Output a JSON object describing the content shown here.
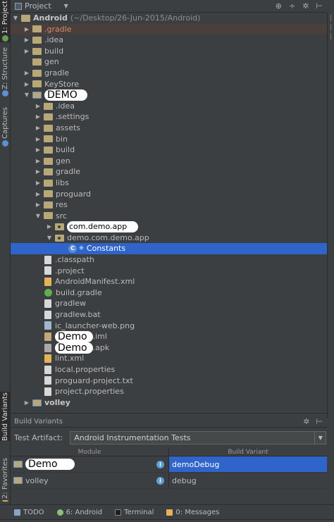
{
  "left_strip": {
    "project": "1: Project",
    "structure": "Z: Structure",
    "captures": "Captures",
    "build_variants": "Build Variants",
    "favorites": "2: Favorites"
  },
  "header": {
    "title": "Project"
  },
  "tree": [
    {
      "label": "Android",
      "path": "(~/Desktop/26-Jun-2015/Android)",
      "bold": true
    },
    {
      "label": ".gradle"
    },
    {
      "label": ".idea"
    },
    {
      "label": "build"
    },
    {
      "label": "gen"
    },
    {
      "label": "gradle"
    },
    {
      "label": "KeyStore"
    },
    {
      "label": "DEMO"
    },
    {
      "label": ".idea"
    },
    {
      "label": ".settings"
    },
    {
      "label": "assets"
    },
    {
      "label": "bin"
    },
    {
      "label": "build"
    },
    {
      "label": "gen"
    },
    {
      "label": "gradle"
    },
    {
      "label": "libs"
    },
    {
      "label": "proguard"
    },
    {
      "label": "res"
    },
    {
      "label": "src"
    },
    {
      "label": "com.demo.app"
    },
    {
      "label": "demo.com.demo.app"
    },
    {
      "label": "Constants"
    },
    {
      "label": ".classpath"
    },
    {
      "label": ".project"
    },
    {
      "label": "AndroidManifest.xml"
    },
    {
      "label": "build.gradle"
    },
    {
      "label": "gradlew"
    },
    {
      "label": "gradlew.bat"
    },
    {
      "label": "ic_launcher-web.png"
    },
    {
      "label": "Demo",
      "suffix": ".iml"
    },
    {
      "label": "Demo",
      "suffix": ".apk"
    },
    {
      "label": "lint.xml"
    },
    {
      "label": "local.properties"
    },
    {
      "label": "proguard-project.txt"
    },
    {
      "label": "project.properties"
    },
    {
      "label": "volley"
    }
  ],
  "build_variants": {
    "title": "Build Variants",
    "artifact_label": "Test Artifact:",
    "artifact_value": "Android Instrumentation Tests",
    "col_module": "Module",
    "col_variant": "Build Variant",
    "rows": [
      {
        "module": "Demo",
        "variant": "demoDebug"
      },
      {
        "module": "volley",
        "variant": "debug"
      }
    ]
  },
  "bottom_tabs": {
    "todo": "TODO",
    "android": "6: Android",
    "terminal": "Terminal",
    "messages": "0: Messages"
  },
  "colors": {
    "selection": "#2f65ca",
    "background": "#3c3f41",
    "folder": "#b8a777"
  }
}
